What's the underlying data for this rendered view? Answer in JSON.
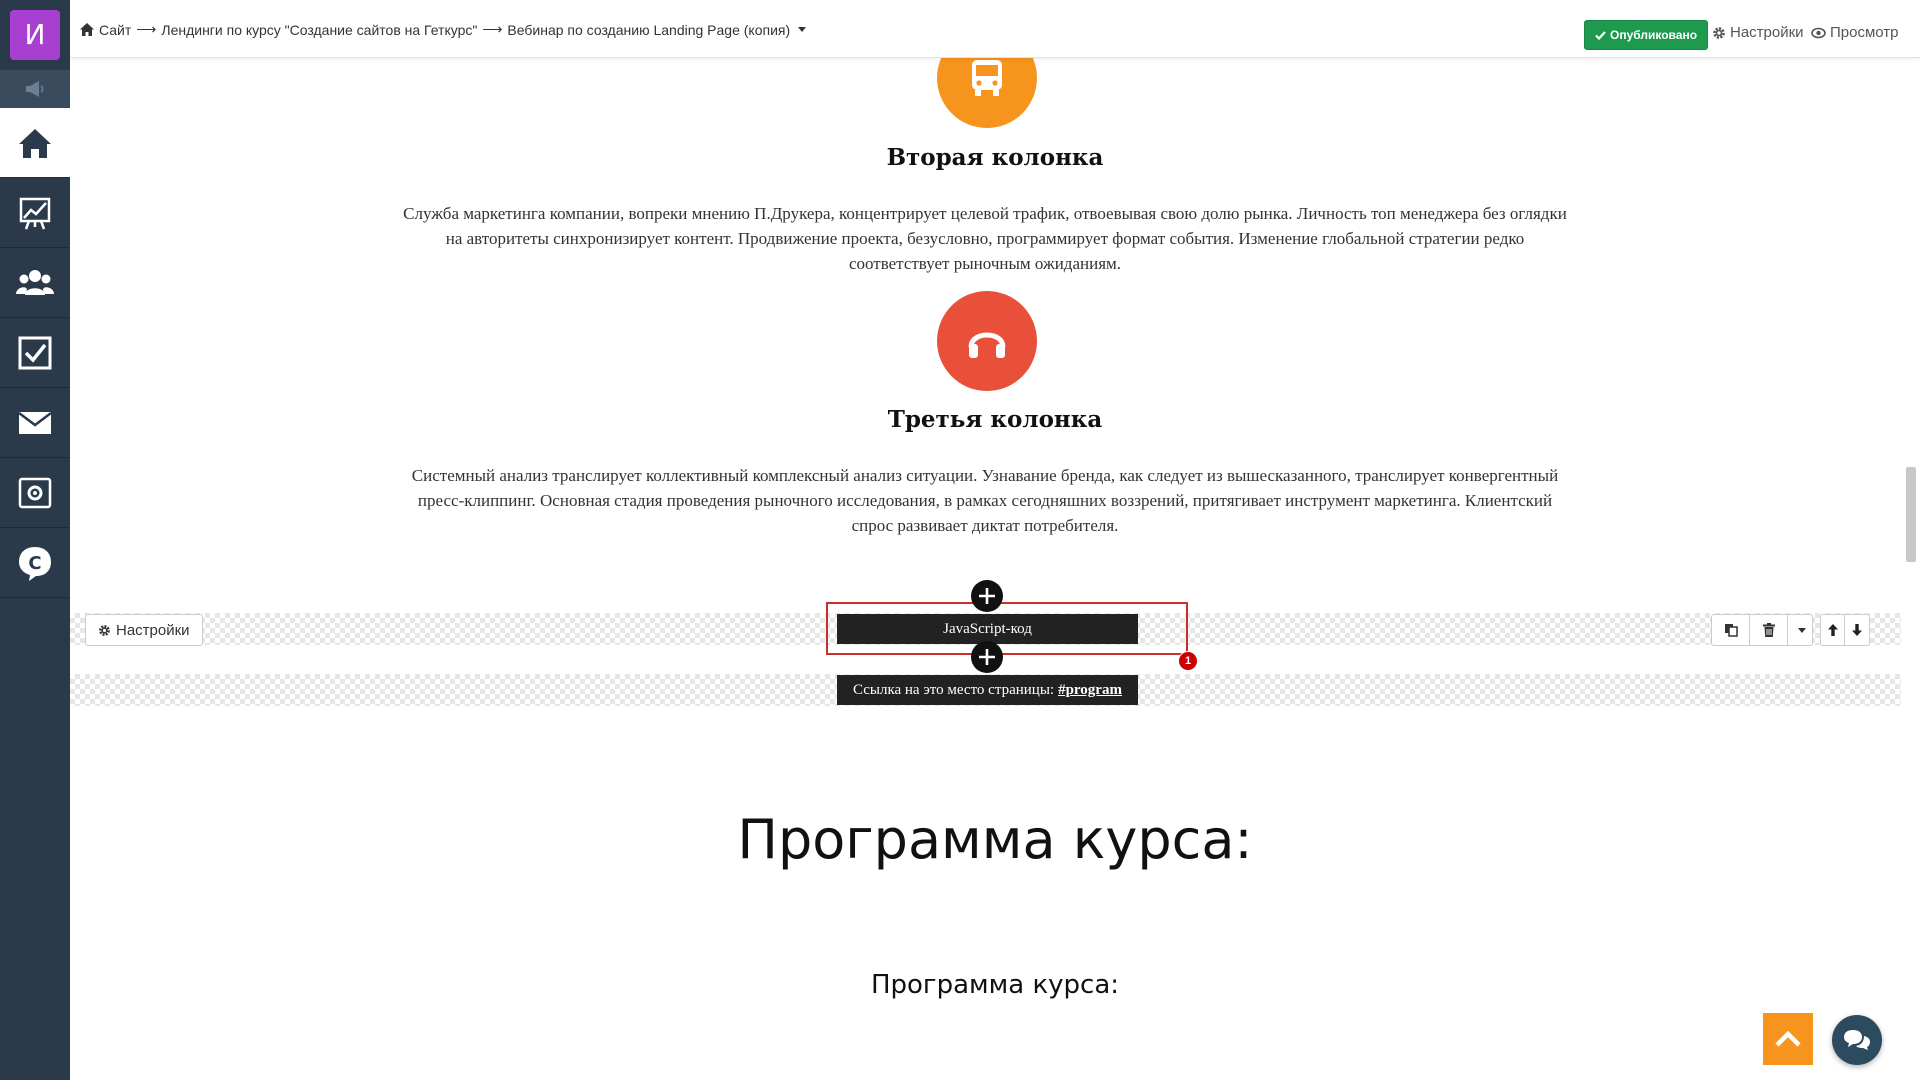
{
  "sidebar": {
    "logo_letter": "И",
    "items": [
      {
        "name": "home",
        "icon": "home-icon"
      },
      {
        "name": "statistics",
        "icon": "chart-icon"
      },
      {
        "name": "users",
        "icon": "users-icon"
      },
      {
        "name": "tasks",
        "icon": "checkbox-icon"
      },
      {
        "name": "messages",
        "icon": "envelope-icon"
      },
      {
        "name": "settings",
        "icon": "gear-box-icon"
      },
      {
        "name": "getcourse",
        "icon": "getcourse-logo-icon"
      }
    ]
  },
  "header": {
    "breadcrumb": {
      "site": "Сайт",
      "arrow": "⟶",
      "section": "Лендинги по курсу \"Создание сайтов на Геткурс\"",
      "page": "Вебинар по созданию Landing Page (копия)"
    },
    "published_label": "Опубликовано",
    "settings_label": "Настройки",
    "preview_label": "Просмотр"
  },
  "columns": [
    {
      "title": "Вторая колонка",
      "text": "Служба маркетинга компании, вопреки мнению П.Друкера, концентрирует целевой трафик, отвоевывая свою долю рынка. Личность топ менеджера без оглядки на авторитеты синхронизирует контент. Продвижение проекта, безусловно, программирует формат события. Изменение глобальной стратегии редко соответствует рыночным ожиданиям.",
      "icon": "bus-icon",
      "color": "#f7941d"
    },
    {
      "title": "Третья колонка",
      "text": "Системный анализ транслирует коллективный комплексный анализ ситуации. Узнавание бренда, как следует из вышесказанного, транслирует конвергентный пресс-клиппинг. Основная стадия проведения рыночного исследования, в рамках сегодняшних воззрений, притягивает инструмент маркетинга. Клиентский спрос развивает диктат потребителя.",
      "icon": "headphones-icon",
      "color": "#e8503a"
    }
  ],
  "block": {
    "settings_label": "Настройки",
    "js_label": "JavaScript-код",
    "badge": "1",
    "anchor_prefix": "Ссылка на это место страницы:",
    "anchor_link": "#program"
  },
  "program": {
    "heading": "Программа курса:",
    "subheading": "Программа курса:"
  },
  "colors": {
    "sidebar_bg": "#2b3a4a",
    "logo_bg": "#a93fd1",
    "published": "#1e9a4f",
    "accent_orange": "#f7941d",
    "accent_red": "#e8503a",
    "frame_red": "#c9302c"
  }
}
